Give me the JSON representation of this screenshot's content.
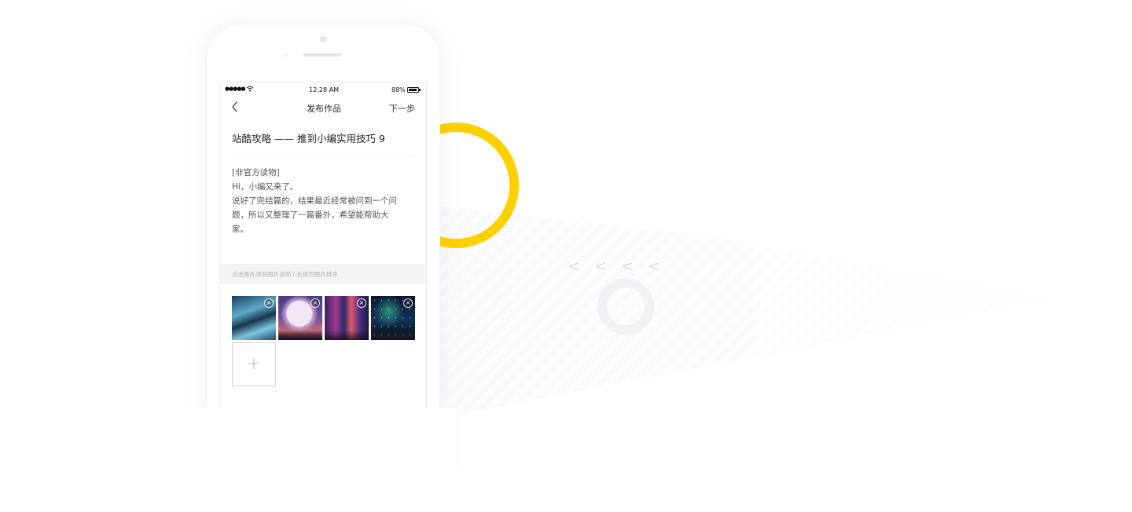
{
  "status_bar": {
    "signal": "●●●●●",
    "time": "12:28 AM",
    "battery": "88%"
  },
  "nav": {
    "title": "发布作品",
    "next": "下一步"
  },
  "post": {
    "title": "站酷攻略 —— 推到小编实用技巧 9",
    "body_lines": [
      "[非官方读物]",
      "Hi，小编又来了。",
      "说好了完结篇的，结果最近经常被问到一个问",
      "题，所以又整理了一篇番外，希望能帮助大",
      "家。"
    ]
  },
  "hint": "点击图片添加图片说明  /  长按为图片排序",
  "images": [
    {
      "name": "blue-wave-image",
      "close": "×"
    },
    {
      "name": "purple-moon-image",
      "close": "×"
    },
    {
      "name": "neon-city-image",
      "close": "×"
    },
    {
      "name": "night-sky-image",
      "close": "×"
    }
  ],
  "add_button": "+",
  "decor": {
    "chevrons": "< < < <",
    "accent_color": "#FFD000"
  }
}
